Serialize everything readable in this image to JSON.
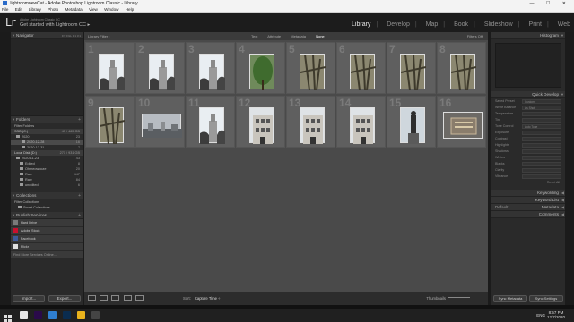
{
  "window": {
    "title": "lightroomnewCat - Adobe Photoshop Lightroom Classic - Library",
    "controls": [
      "—",
      "☐",
      "✕"
    ]
  },
  "menu": [
    "File",
    "Edit",
    "Library",
    "Photo",
    "Metadata",
    "View",
    "Window",
    "Help"
  ],
  "identity": {
    "logo": "Lr",
    "subtitle": "Adobe Lightroom Classic CC",
    "title": "Get started with Lightroom CC",
    "title_arrow": "▸"
  },
  "modules": {
    "items": [
      "Library",
      "Develop",
      "Map",
      "Book",
      "Slideshow",
      "Print",
      "Web"
    ],
    "active": "Library"
  },
  "left_panel": {
    "navigator": {
      "label": "Navigator",
      "modes": "FIT  FILL  1:1  3:1"
    },
    "folders": {
      "label": "Folders",
      "filter_label": "Filter Folders",
      "volume": {
        "name": "SSD (C:)",
        "info": "43 / 465 GB"
      },
      "tree": [
        {
          "name": "2020",
          "count": "23",
          "hl": false
        },
        {
          "name": "2020-12-28",
          "count": "16",
          "hl": true
        },
        {
          "name": "2020-12-31",
          "count": "7",
          "hl": false
        }
      ],
      "volume2": {
        "name": "Local Disk (D:)",
        "info": "271 / 931 GB"
      },
      "tree2": [
        {
          "name": "2020-11-23",
          "count": "43"
        },
        {
          "name": "Edited",
          "count": "8"
        },
        {
          "name": "Ohmeowpoze",
          "count": "20"
        },
        {
          "name": "Raw",
          "count": "447"
        },
        {
          "name": "Raw",
          "count": "84"
        },
        {
          "name": "unedited",
          "count": "6"
        }
      ]
    },
    "collections": {
      "label": "Collections",
      "filter_label": "Filter Collections",
      "items": [
        "Smart Collections"
      ]
    },
    "publish": {
      "label": "Publish Services",
      "items": [
        {
          "name": "Hard Drive",
          "icon_color": "#7a7a7a"
        },
        {
          "name": "Adobe Stock",
          "icon_color": "#c8102e"
        },
        {
          "name": "Facebook",
          "icon_color": "#3b5998"
        },
        {
          "name": "Flickr",
          "icon_color": "#e0e0e0"
        }
      ],
      "find_more": "Find More Services Online..."
    },
    "import_label": "Import...",
    "export_label": "Export..."
  },
  "center": {
    "filter_title": "Library Filter :",
    "filter_options": [
      "Text",
      "Attribute",
      "Metadata",
      "None"
    ],
    "filter_active": "None",
    "filter_right": "Filters Off",
    "grid_numbers": [
      "1",
      "2",
      "3",
      "4",
      "5",
      "6",
      "7",
      "8",
      "9",
      "10",
      "11",
      "12",
      "13",
      "14",
      "15",
      "16"
    ],
    "thumb_kinds": [
      "tower",
      "tower",
      "tower",
      "tree",
      "branch",
      "branch",
      "branch",
      "branch",
      "branch",
      "city",
      "tower",
      "building",
      "building",
      "building",
      "statue",
      "plaque"
    ],
    "toolbar": {
      "sort_label": "Sort:",
      "sort_value": "Capture Time ÷",
      "thumbnails_label": "Thumbnails"
    }
  },
  "right_panel": {
    "histogram_label": "Histogram",
    "quick_develop_label": "Quick Develop",
    "qd_groups": [
      {
        "label": "Saved Preset",
        "value": "Custom"
      },
      {
        "label": "White Balance",
        "value": "As Shot"
      },
      {
        "label": "Temperature",
        "value": ""
      },
      {
        "label": "Tint",
        "value": ""
      },
      {
        "label": "Tone Control",
        "value": "Auto Tone"
      },
      {
        "label": "Exposure",
        "value": ""
      },
      {
        "label": "Contrast",
        "value": ""
      },
      {
        "label": "Highlights",
        "value": ""
      },
      {
        "label": "Shadows",
        "value": ""
      },
      {
        "label": "Whites",
        "value": ""
      },
      {
        "label": "Blacks",
        "value": ""
      },
      {
        "label": "Clarity",
        "value": ""
      },
      {
        "label": "Vibrance",
        "value": ""
      }
    ],
    "reset_all": "Reset All",
    "keywording_label": "Keywording",
    "keyword_list_label": "Keyword List",
    "metadata_label": "Metadata",
    "metadata_preset": "Default",
    "comments_label": "Comments",
    "sync_metadata": "Sync Metadata",
    "sync_settings": "Sync Settings"
  },
  "taskbar": {
    "apps": [
      {
        "name": "search-app",
        "color": "#e6e6e6"
      },
      {
        "name": "premiere",
        "color": "#2a0a4a"
      },
      {
        "name": "vscode",
        "color": "#2f7fd1"
      },
      {
        "name": "photoshop",
        "color": "#0a2c4f"
      },
      {
        "name": "chrome",
        "color": "#e8b21c"
      },
      {
        "name": "obs",
        "color": "#444444"
      }
    ],
    "language": "ENG",
    "time": "8:57 PM",
    "date": "12/7/2020"
  },
  "colors": {
    "accent": "#e8e8e8",
    "panel_bg": "#2a2a2a",
    "grid_bg": "#4a4a4a"
  }
}
